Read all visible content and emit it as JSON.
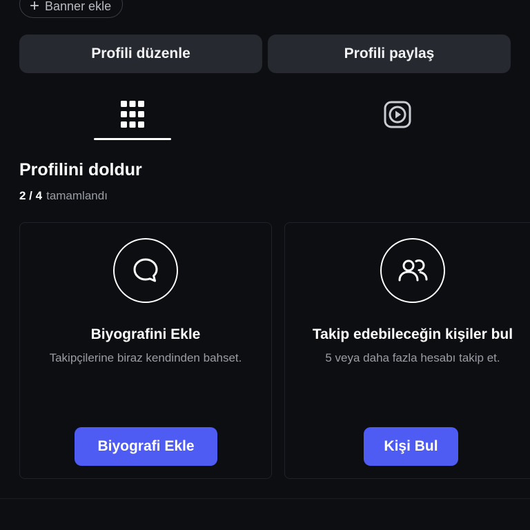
{
  "banner": {
    "label": "Banner ekle",
    "icon": "plus-icon"
  },
  "actions": {
    "edit_label": "Profili düzenle",
    "share_label": "Profili paylaş"
  },
  "tabs": [
    {
      "name": "grid",
      "icon": "grid-icon",
      "active": true
    },
    {
      "name": "reels",
      "icon": "reels-icon",
      "active": false
    }
  ],
  "profile_completion": {
    "title": "Profilini doldur",
    "progress_count": "2 / 4",
    "progress_label": "tamamlandı",
    "cards": [
      {
        "icon": "speech-bubble-icon",
        "title": "Biyografini Ekle",
        "description": "Takipçilerine biraz kendinden bahset.",
        "button_label": "Biyografi Ekle"
      },
      {
        "icon": "people-icon",
        "title": "Takip edebileceğin kişiler bul",
        "description": "5 veya daha fazla hesabı takip et.",
        "button_label": "Kişi Bul"
      }
    ]
  },
  "colors": {
    "background": "#0c0e12",
    "button_bg": "#26292f",
    "accent": "#4e5cf4",
    "muted_text": "#9a9da4"
  }
}
